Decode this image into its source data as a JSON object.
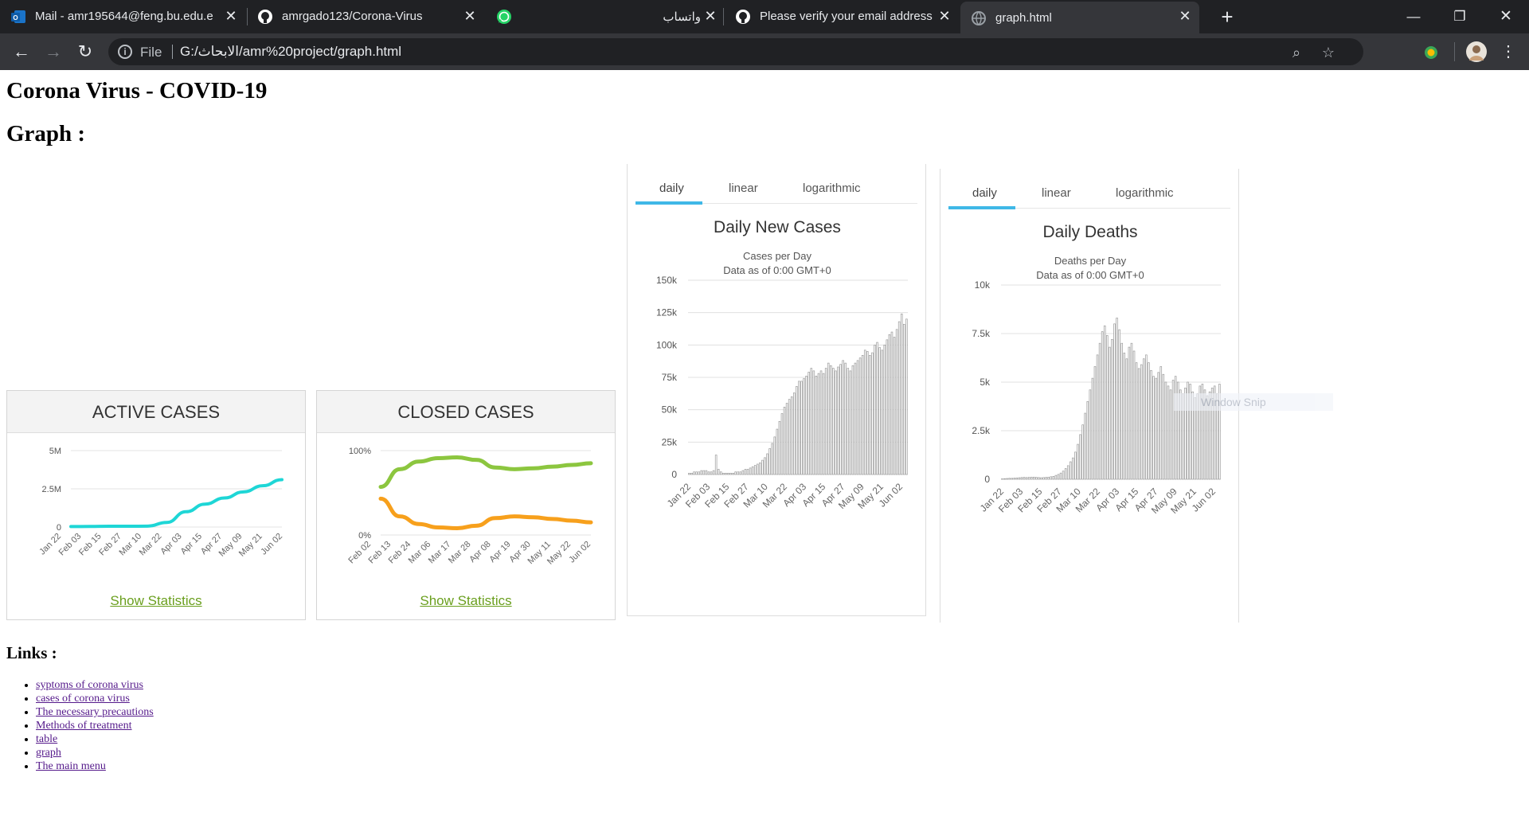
{
  "browser": {
    "tabs": [
      {
        "title": "Mail - amr195644@feng.bu.edu.e",
        "icon": "outlook-icon"
      },
      {
        "title": "amrgado123/Corona-Virus",
        "icon": "github-icon"
      },
      {
        "title": "",
        "icon": "whatsapp-icon"
      },
      {
        "title": "واتساب",
        "icon": ""
      },
      {
        "title": "Please verify your email address",
        "icon": "github-icon"
      },
      {
        "title": "graph.html",
        "icon": "globe-icon"
      }
    ],
    "file_label": "File",
    "url": "G:/الابحاث/amr%20project/graph.html"
  },
  "page": {
    "title": "Corona Virus - COVID-19",
    "graph_heading": "Graph :",
    "links_heading": "Links :",
    "links": [
      "syptoms of corona virus",
      "cases of corona virus",
      "The necessary precautions",
      "Methods of treatment",
      "table",
      "graph",
      "The main menu"
    ]
  },
  "cards": {
    "active": {
      "title": "ACTIVE CASES",
      "link": "Show Statistics"
    },
    "closed": {
      "title": "CLOSED CASES",
      "link": "Show Statistics"
    }
  },
  "panels": {
    "tabs": [
      "daily",
      "linear",
      "logarithmic"
    ],
    "new_cases": {
      "title": "Daily New Cases",
      "subtitle": "Cases per Day",
      "subtitle2": "Data as of 0:00 GMT+0"
    },
    "deaths": {
      "title": "Daily Deaths",
      "subtitle": "Deaths per Day",
      "subtitle2": "Data as of 0:00 GMT+0"
    }
  },
  "overlay": {
    "window_snip": "Window Snip"
  },
  "colors": {
    "active_line": "#1ed6d6",
    "recovered_line": "#8cc63f",
    "deaths_line": "#f7a01c",
    "tab_accent": "#3fb8e7",
    "bars": "#999999"
  },
  "chart_data": [
    {
      "type": "line",
      "title": "ACTIVE CASES",
      "x_ticks": [
        "Jan 22",
        "Feb 03",
        "Feb 15",
        "Feb 27",
        "Mar 10",
        "Mar 22",
        "Apr 03",
        "Apr 15",
        "Apr 27",
        "May 09",
        "May 21",
        "Jun 02"
      ],
      "y_ticks": [
        "0",
        "2.5M",
        "5M"
      ],
      "ylim": [
        0,
        5000000
      ],
      "series": [
        {
          "values": [
            0.03,
            0.04,
            0.05,
            0.05,
            0.06,
            0.3,
            1.0,
            1.5,
            1.9,
            2.3,
            2.7,
            3.1
          ]
        }
      ]
    },
    {
      "type": "line",
      "title": "CLOSED CASES",
      "x_ticks": [
        "Feb 02",
        "Feb 13",
        "Feb 24",
        "Mar 06",
        "Mar 17",
        "Mar 28",
        "Apr 08",
        "Apr 19",
        "Apr 30",
        "May 11",
        "May 22",
        "Jun 02"
      ],
      "y_ticks": [
        "0%",
        "100%"
      ],
      "ylim": [
        0,
        100
      ],
      "series": [
        {
          "values": [
            57,
            78,
            87,
            91,
            92,
            89,
            80,
            78,
            79,
            81,
            83,
            85
          ]
        },
        {
          "values": [
            43,
            22,
            13,
            9,
            8,
            11,
            20,
            22,
            21,
            19,
            17,
            15
          ]
        }
      ]
    },
    {
      "type": "bar",
      "title": "Daily New Cases",
      "x_ticks": [
        "Jan 22",
        "Feb 03",
        "Feb 15",
        "Feb 27",
        "Mar 10",
        "Mar 22",
        "Apr 03",
        "Apr 15",
        "Apr 27",
        "May 09",
        "May 21",
        "Jun 02"
      ],
      "y_ticks": [
        "0",
        "25k",
        "50k",
        "75k",
        "100k",
        "125k",
        "150k"
      ],
      "ylim": [
        0,
        150000
      ],
      "values_k": [
        1,
        1,
        2,
        2,
        2,
        3,
        3,
        3,
        2,
        2,
        3,
        15,
        4,
        2,
        1,
        1,
        1,
        1,
        1,
        2,
        2,
        2,
        3,
        4,
        4,
        5,
        6,
        7,
        8,
        9,
        11,
        13,
        16,
        20,
        24,
        29,
        35,
        41,
        47,
        52,
        55,
        58,
        60,
        63,
        68,
        72,
        72,
        74,
        76,
        79,
        82,
        80,
        76,
        78,
        80,
        78,
        82,
        86,
        84,
        82,
        80,
        83,
        85,
        88,
        86,
        82,
        80,
        84,
        86,
        88,
        90,
        92,
        96,
        95,
        92,
        94,
        100,
        102,
        98,
        96,
        100,
        104,
        108,
        110,
        106,
        112,
        118,
        124,
        116,
        120
      ]
    },
    {
      "type": "bar",
      "title": "Daily Deaths",
      "x_ticks": [
        "Jan 22",
        "Feb 03",
        "Feb 15",
        "Feb 27",
        "Mar 10",
        "Mar 22",
        "Apr 03",
        "Apr 15",
        "Apr 27",
        "May 09",
        "May 21",
        "Jun 02"
      ],
      "y_ticks": [
        "0",
        "2.5k",
        "5k",
        "7.5k",
        "10k"
      ],
      "ylim": [
        0,
        10000
      ],
      "values": [
        20,
        30,
        40,
        50,
        50,
        60,
        70,
        80,
        90,
        100,
        90,
        100,
        110,
        110,
        100,
        90,
        80,
        90,
        100,
        110,
        130,
        150,
        200,
        250,
        320,
        420,
        550,
        700,
        900,
        1100,
        1400,
        1800,
        2300,
        2800,
        3400,
        4000,
        4600,
        5200,
        5800,
        6400,
        7000,
        7600,
        7900,
        7400,
        6800,
        7200,
        8000,
        8300,
        7700,
        7000,
        6500,
        6200,
        6800,
        7000,
        6600,
        6000,
        5700,
        5900,
        6200,
        6400,
        6000,
        5600,
        5300,
        5200,
        5500,
        5800,
        5400,
        5000,
        4800,
        4600,
        5100,
        5300,
        5000,
        4600,
        4400,
        4700,
        5000,
        4900,
        4500,
        4200,
        4400,
        4800,
        4900,
        4600,
        4300,
        4500,
        4700,
        4800,
        4400,
        4900
      ]
    }
  ]
}
